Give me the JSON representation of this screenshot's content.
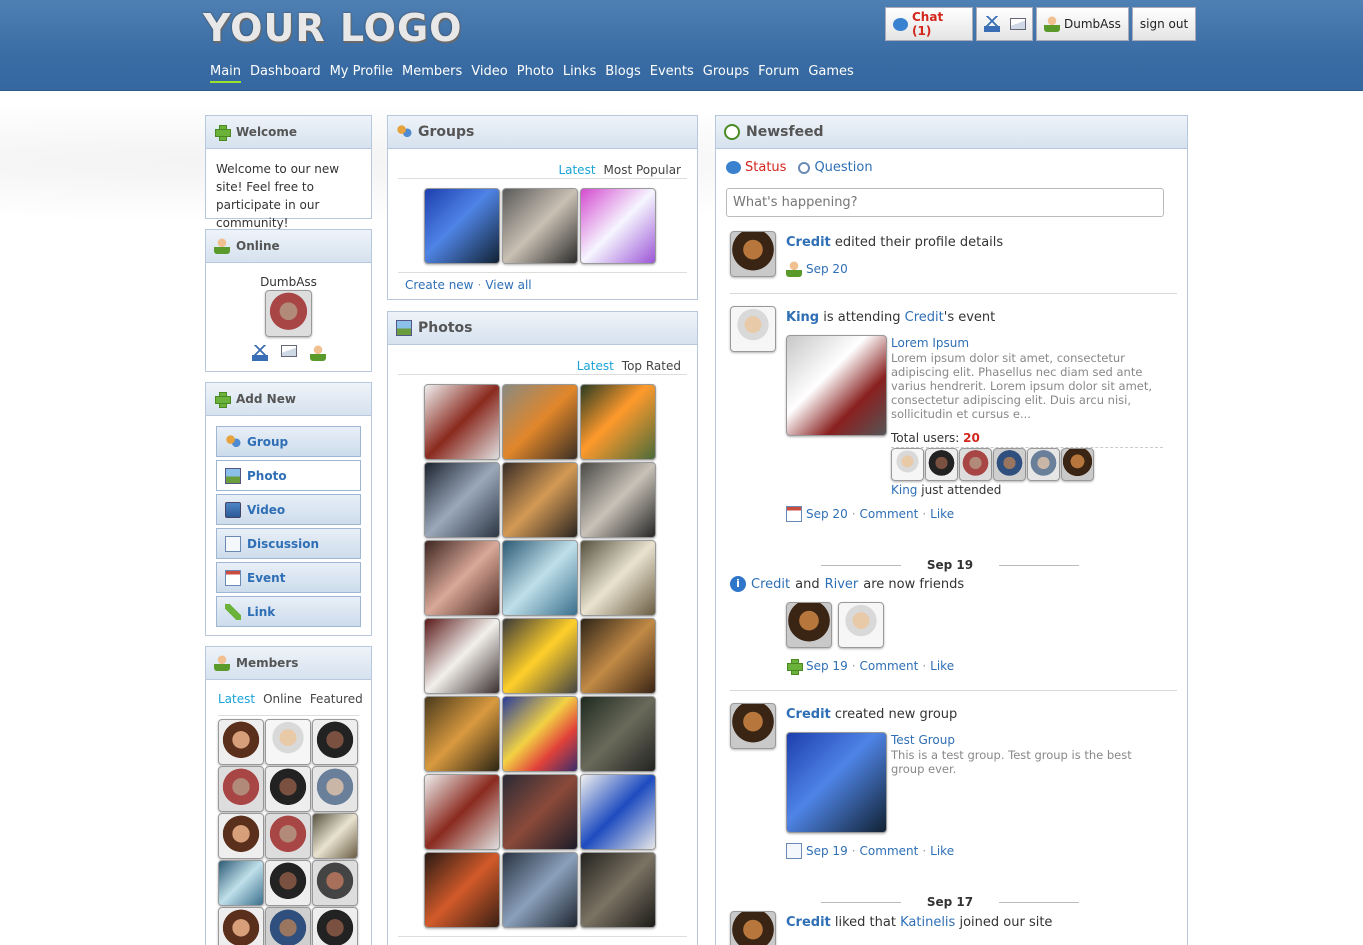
{
  "header": {
    "logo_text": "YOUR LOGO",
    "chat_label": "Chat (1)",
    "username": "DumbAss",
    "signout_label": "sign out",
    "nav": [
      "Main",
      "Dashboard",
      "My Profile",
      "Members",
      "Video",
      "Photo",
      "Links",
      "Blogs",
      "Events",
      "Groups",
      "Forum",
      "Games"
    ],
    "active_nav": "Main"
  },
  "welcome": {
    "title": "Welcome",
    "text": "Welcome to our new site! Feel free to participate in our community!"
  },
  "online": {
    "title": "Online",
    "user": "DumbAss"
  },
  "addnew": {
    "title": "Add New",
    "items": [
      "Group",
      "Photo",
      "Video",
      "Discussion",
      "Event",
      "Link"
    ]
  },
  "members": {
    "title": "Members",
    "tabs": [
      "Latest",
      "Online",
      "Featured"
    ]
  },
  "groups": {
    "title": "Groups",
    "tabs": [
      "Latest",
      "Most Popular"
    ],
    "create_label": "Create new",
    "view_label": "View all",
    "separator": "·"
  },
  "photos": {
    "title": "Photos",
    "tabs": [
      "Latest",
      "Top Rated"
    ]
  },
  "newsfeed": {
    "title": "Newsfeed",
    "status_label": "Status",
    "question_label": "Question",
    "input_placeholder": "What's happening?",
    "item1": {
      "user": "Credit",
      "action": "edited their profile details",
      "date": "Sep 20"
    },
    "item2": {
      "user": "King",
      "action_pre": "is attending",
      "event_owner": "Credit",
      "action_post": "'s event",
      "event_title": "Lorem Ipsum",
      "event_desc": "Lorem ipsum dolor sit amet, consectetur adipiscing elit. Phasellus nec diam sed ante varius hendrerit. Lorem ipsum dolor sit amet, consectetur adipiscing elit. Duis arcu nisi, sollicitudin et cursus e...",
      "total_label": "Total users:",
      "total_value": "20",
      "attended_user": "King",
      "attended_text": "just attended",
      "date": "Sep 20",
      "comment": "Comment",
      "like": "Like"
    },
    "date_sep1": "Sep 19",
    "item3": {
      "user1": "Credit",
      "and": "and",
      "user2": "River",
      "text": "are now friends",
      "date": "Sep 19",
      "comment": "Comment",
      "like": "Like"
    },
    "item4": {
      "user": "Credit",
      "action": "created new group",
      "group_title": "Test Group",
      "group_desc": "This is a test group. Test group is the best group ever.",
      "date": "Sep 19",
      "comment": "Comment",
      "like": "Like"
    },
    "date_sep2": "Sep 17",
    "item5": {
      "user1": "Credit",
      "text1": "liked that",
      "user2": "Katinelis",
      "text2": "joined our site"
    }
  },
  "colors": {
    "header_blue": "#3a6da4",
    "link": "#2f6fb5",
    "chat_red": "#d3261c",
    "active_tab": "#1aa3d8",
    "accent_green": "#9be02a"
  }
}
